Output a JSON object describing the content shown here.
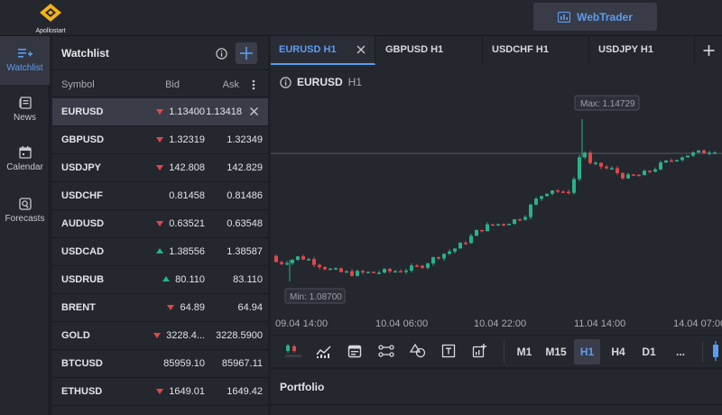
{
  "brand": {
    "name": "Apollostart"
  },
  "header": {
    "webtrader_label": "WebTrader"
  },
  "nav": [
    {
      "label": "Watchlist",
      "icon": "watchlist-icon",
      "active": true
    },
    {
      "label": "News",
      "icon": "news-icon",
      "active": false
    },
    {
      "label": "Calendar",
      "icon": "calendar-icon",
      "active": false
    },
    {
      "label": "Forecasts",
      "icon": "forecasts-icon",
      "active": false
    }
  ],
  "watchlist": {
    "title": "Watchlist",
    "columns": {
      "symbol": "Symbol",
      "bid": "Bid",
      "ask": "Ask"
    },
    "rows": [
      {
        "symbol": "EURUSD",
        "bid": "1.13400",
        "ask": "1.13418",
        "trend": "down",
        "selected": true
      },
      {
        "symbol": "GBPUSD",
        "bid": "1.32319",
        "ask": "1.32349",
        "trend": "down"
      },
      {
        "symbol": "USDJPY",
        "bid": "142.808",
        "ask": "142.829",
        "trend": "down"
      },
      {
        "symbol": "USDCHF",
        "bid": "0.81458",
        "ask": "0.81486",
        "trend": "none"
      },
      {
        "symbol": "AUDUSD",
        "bid": "0.63521",
        "ask": "0.63548",
        "trend": "down"
      },
      {
        "symbol": "USDCAD",
        "bid": "1.38556",
        "ask": "1.38587",
        "trend": "up"
      },
      {
        "symbol": "USDRUB",
        "bid": "80.110",
        "ask": "83.110",
        "trend": "up"
      },
      {
        "symbol": "BRENT",
        "bid": "64.89",
        "ask": "64.94",
        "trend": "down"
      },
      {
        "symbol": "GOLD",
        "bid": "3228.4...",
        "ask": "3228.5900",
        "trend": "down"
      },
      {
        "symbol": "BTCUSD",
        "bid": "85959.10",
        "ask": "85967.11",
        "trend": "none"
      },
      {
        "symbol": "ETHUSD",
        "bid": "1649.01",
        "ask": "1649.42",
        "trend": "down"
      }
    ]
  },
  "tabs": [
    {
      "label": "EURUSD H1",
      "active": true
    },
    {
      "label": "GBPUSD H1",
      "active": false
    },
    {
      "label": "USDCHF H1",
      "active": false
    },
    {
      "label": "USDJPY H1",
      "active": false
    }
  ],
  "chart": {
    "symbol": "EURUSD",
    "timeframe": "H1",
    "max_label": "Max: 1.14729",
    "min_label": "Min: 1.08700",
    "x_labels": [
      "09.04 14:00",
      "10.04 06:00",
      "10.04 22:00",
      "11.04 14:00",
      "14.04 07:00"
    ]
  },
  "chart_data": {
    "type": "candlestick",
    "x": [
      "09.04 14:00",
      "10.04 06:00",
      "10.04 22:00",
      "11.04 14:00",
      "14.04 07:00"
    ],
    "y_max": 1.14729,
    "y_min": 1.087,
    "current_level": 1.134,
    "colors": {
      "up": "#26b38a",
      "down": "#e04848"
    }
  },
  "toolbar": {
    "timeframes": [
      "M1",
      "M15",
      "H1",
      "H4",
      "D1"
    ],
    "active_timeframe": "H1",
    "more_label": "..."
  },
  "portfolio": {
    "title": "Portfolio"
  }
}
